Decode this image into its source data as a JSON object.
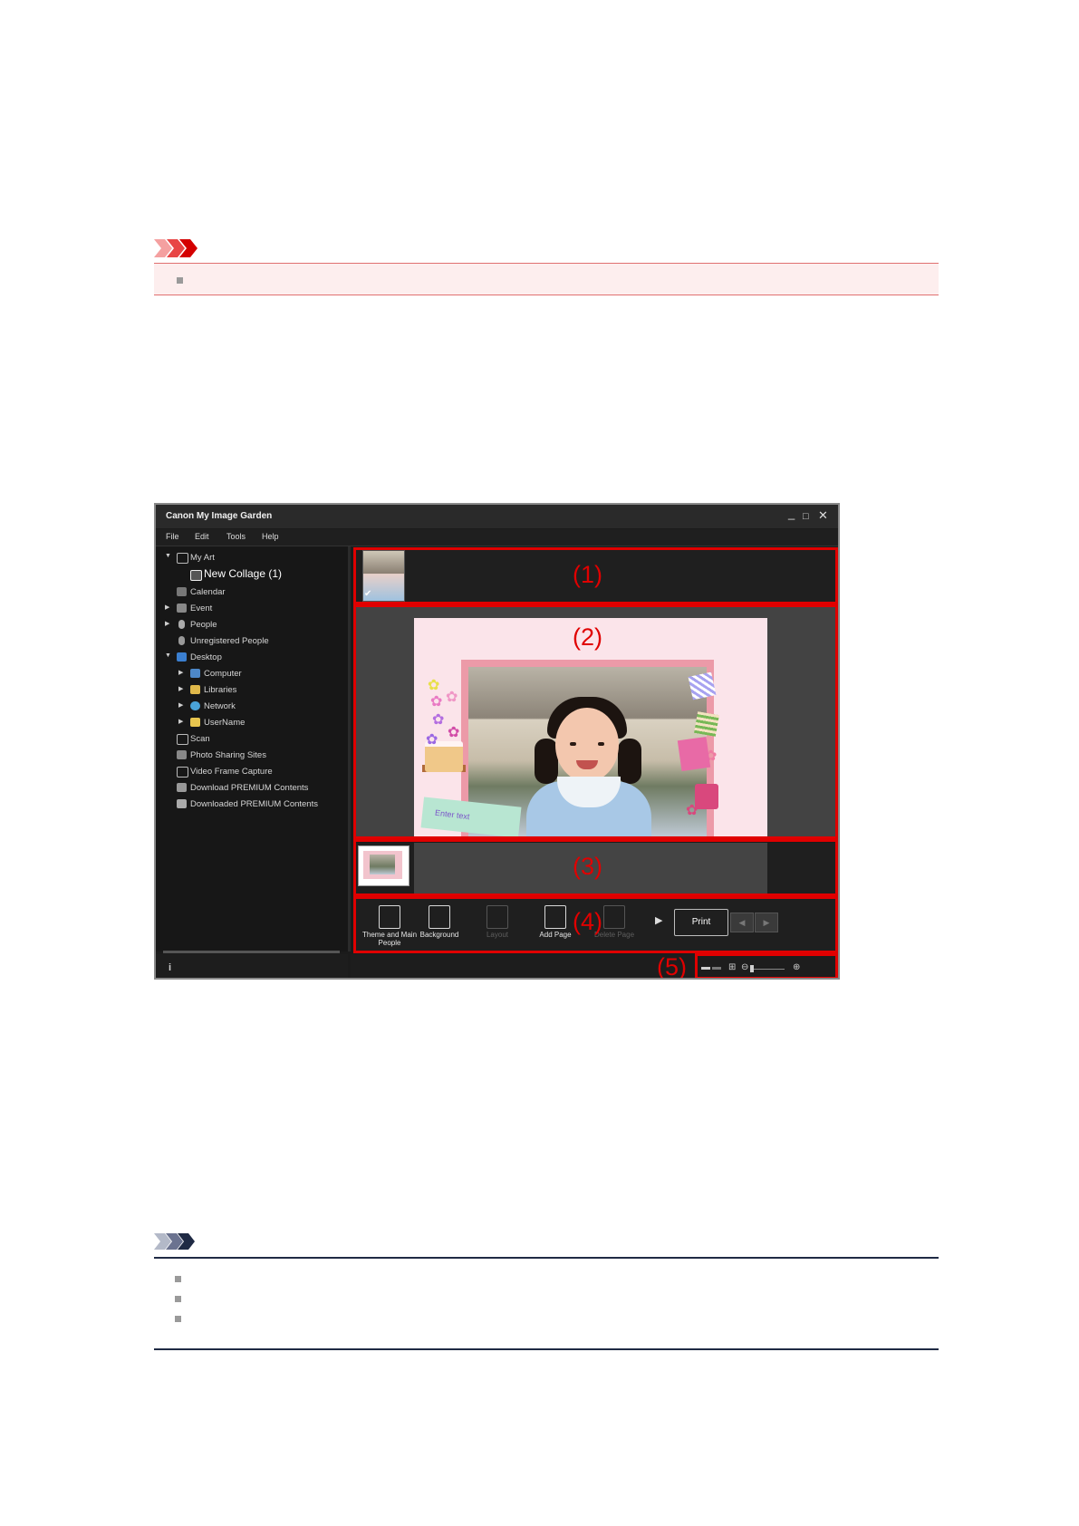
{
  "window": {
    "title": "Canon My Image Garden",
    "controls": [
      "_",
      "□",
      "✕"
    ]
  },
  "menu": [
    "File",
    "Edit",
    "Tools",
    "Help"
  ],
  "sidebar": {
    "items": [
      {
        "label": "My Art",
        "icon": "my-art-icon",
        "arrow": "▼"
      },
      {
        "label": "New Collage (1)",
        "icon": "collage-icon",
        "arrow": ""
      },
      {
        "label": "Calendar",
        "icon": "calendar-icon",
        "arrow": ""
      },
      {
        "label": "Event",
        "icon": "event-icon",
        "arrow": "▶"
      },
      {
        "label": "People",
        "icon": "people-icon",
        "arrow": "▶"
      },
      {
        "label": "Unregistered People",
        "icon": "unregistered-people-icon",
        "arrow": ""
      },
      {
        "label": "Desktop",
        "icon": "desktop-icon",
        "arrow": "▼"
      },
      {
        "label": "Computer",
        "icon": "computer-icon",
        "arrow": "▶"
      },
      {
        "label": "Libraries",
        "icon": "libraries-icon",
        "arrow": "▶"
      },
      {
        "label": "Network",
        "icon": "network-icon",
        "arrow": "▶"
      },
      {
        "label": "UserName",
        "icon": "folder-icon",
        "arrow": "▶"
      },
      {
        "label": "Scan",
        "icon": "scan-icon",
        "arrow": ""
      },
      {
        "label": "Photo Sharing Sites",
        "icon": "photo-sharing-icon",
        "arrow": ""
      },
      {
        "label": "Video Frame Capture",
        "icon": "video-frame-icon",
        "arrow": ""
      },
      {
        "label": "Download PREMIUM Contents",
        "icon": "download-icon",
        "arrow": ""
      },
      {
        "label": "Downloaded PREMIUM Contents",
        "icon": "downloaded-icon",
        "arrow": ""
      }
    ]
  },
  "callouts": [
    "(1)",
    "(2)",
    "(3)",
    "(4)",
    "(5)"
  ],
  "canvas": {
    "enter_text": "Enter text"
  },
  "toolbar": {
    "buttons": [
      {
        "label": "Theme and Main People",
        "enabled": true
      },
      {
        "label": "Background",
        "enabled": true
      },
      {
        "label": "Layout",
        "enabled": false
      },
      {
        "label": "Add Page",
        "enabled": true
      },
      {
        "label": "Delete Page",
        "enabled": false
      }
    ],
    "print_label": "Print"
  },
  "status": {
    "info": "i"
  },
  "colors": {
    "highlight_red": "#e00000",
    "window_bg": "#1b1b1b",
    "important_bg": "#fdeeee",
    "note_line": "#1f2a44"
  }
}
